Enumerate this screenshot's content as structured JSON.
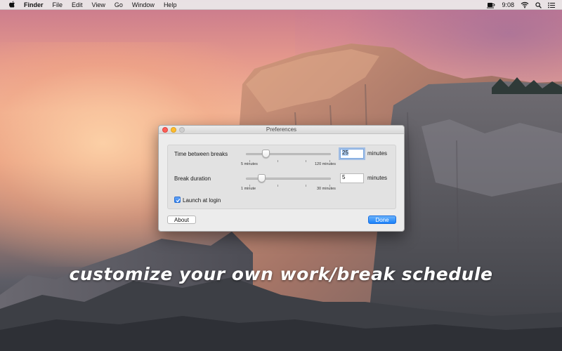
{
  "menubar": {
    "apple_icon": "apple-logo-icon",
    "app_name": "Finder",
    "items": [
      "File",
      "Edit",
      "View",
      "Go",
      "Window",
      "Help"
    ],
    "status": {
      "coffee_icon": "coffee-cup-icon",
      "time": "9:08",
      "wifi_icon": "wifi-icon",
      "search_icon": "spotlight-search-icon",
      "list_icon": "notification-center-icon"
    }
  },
  "window": {
    "title": "Preferences",
    "break_interval": {
      "label": "Time between breaks",
      "value": "25",
      "slider_fraction": 0.2,
      "min_label": "5 minutes",
      "max_label": "120 minutes",
      "unit": "minutes"
    },
    "break_duration": {
      "label": "Break duration",
      "value": "5",
      "slider_fraction": 0.15,
      "min_label": "1 minute",
      "max_label": "30 minutes",
      "unit": "minutes"
    },
    "launch_at_login": {
      "label": "Launch at login",
      "checked": true
    },
    "about_label": "About",
    "done_label": "Done"
  },
  "tagline": "customize your own work/break schedule"
}
